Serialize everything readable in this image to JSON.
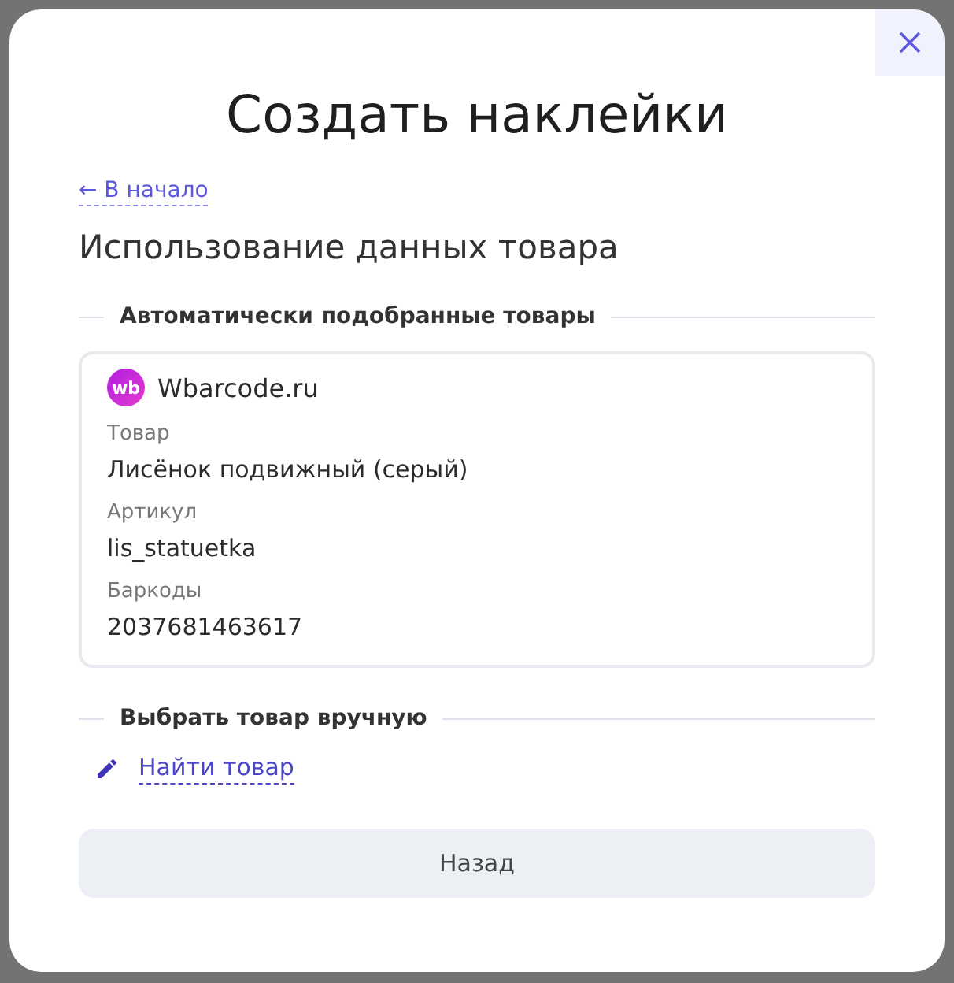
{
  "dialog": {
    "title": "Создать наклейки",
    "back_link": "← В начало",
    "heading": "Использование данных товара",
    "auto_section": {
      "title": "Автоматически подобранные товары",
      "card": {
        "source_logo": "wb",
        "source": "Wbarcode.ru",
        "fields": [
          {
            "label": "Товар",
            "value": "Лисёнок подвижный (серый)"
          },
          {
            "label": "Артикул",
            "value": "lis_statuetka"
          },
          {
            "label": "Баркоды",
            "value": "2037681463617"
          }
        ]
      }
    },
    "manual_section": {
      "title": "Выбрать товар вручную",
      "link": "Найти товар"
    },
    "buttons": [
      "Назад"
    ]
  }
}
